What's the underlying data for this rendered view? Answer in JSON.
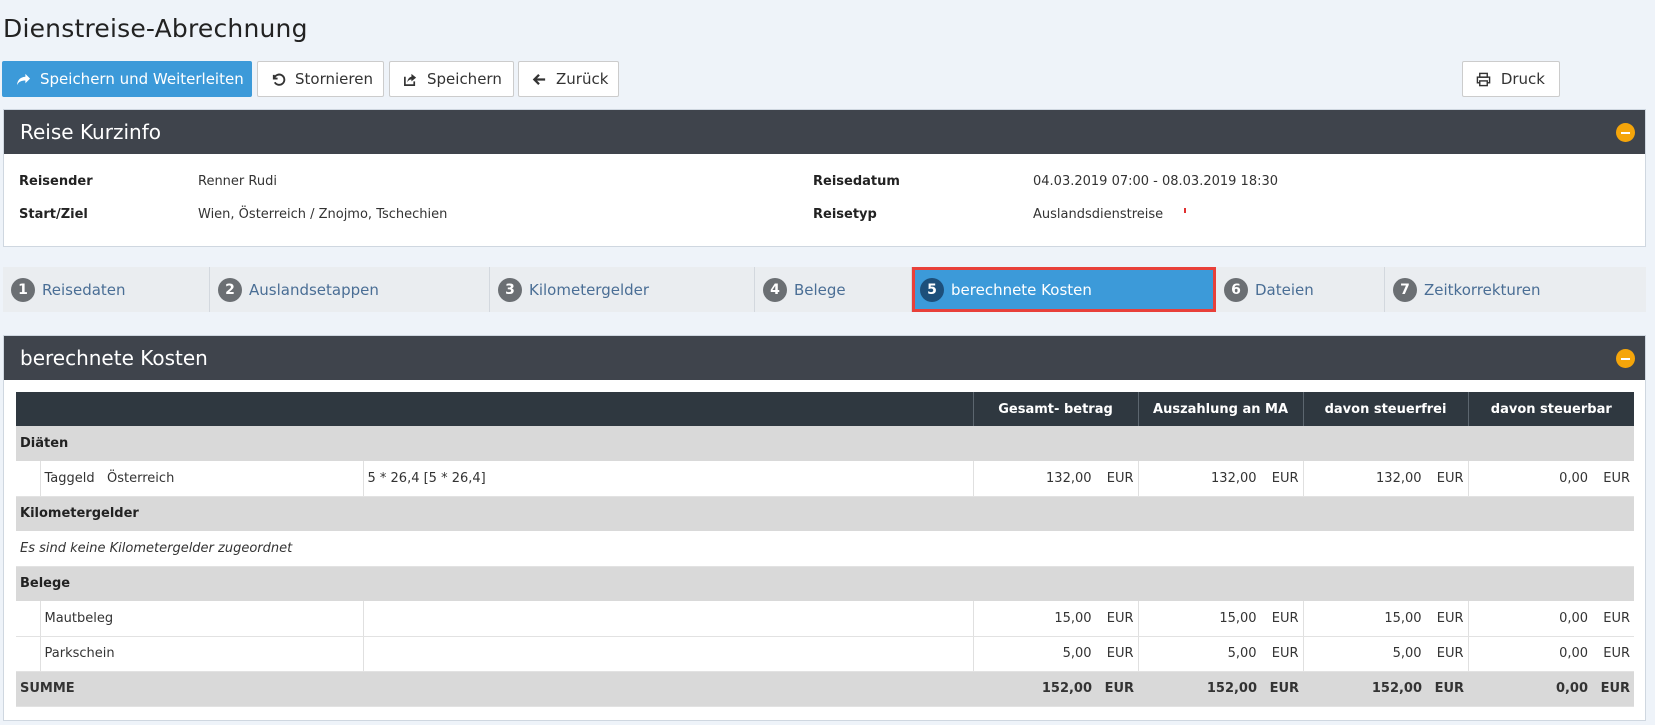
{
  "page": {
    "title": "Dienstreise-Abrechnung"
  },
  "toolbar": {
    "save_forward": "Speichern und Weiterleiten",
    "cancel": "Stornieren",
    "save": "Speichern",
    "back": "Zurück",
    "print": "Druck"
  },
  "info_panel": {
    "title": "Reise Kurzinfo",
    "traveler_label": "Reisender",
    "traveler_value": "Renner Rudi",
    "route_label": "Start/Ziel",
    "route_value": "Wien, Österreich / Znojmo, Tschechien",
    "date_label": "Reisedatum",
    "date_value": "04.03.2019 07:00 - 08.03.2019 18:30",
    "type_label": "Reisetyp",
    "type_value": "Auslandsdienstreise"
  },
  "tabs": [
    {
      "num": "1",
      "label": "Reisedaten"
    },
    {
      "num": "2",
      "label": "Auslandsetappen"
    },
    {
      "num": "3",
      "label": "Kilometergelder"
    },
    {
      "num": "4",
      "label": "Belege"
    },
    {
      "num": "5",
      "label": "berechnete Kosten",
      "active": true
    },
    {
      "num": "6",
      "label": "Dateien"
    },
    {
      "num": "7",
      "label": "Zeitkorrekturen"
    }
  ],
  "costs_panel": {
    "title": "berechnete Kosten",
    "columns": [
      "Gesamt- betrag",
      "Auszahlung an MA",
      "davon steuerfrei",
      "davon steuerbar"
    ],
    "currency": "EUR",
    "group_diaeten": "Diäten",
    "taggeld": {
      "label": "Taggeld",
      "country": "Österreich",
      "formula": "5 * 26,4 [5 * 26,4]",
      "values": [
        "132,00",
        "132,00",
        "132,00",
        "0,00"
      ]
    },
    "group_km": "Kilometergelder",
    "km_empty": "Es sind keine Kilometergelder zugeordnet",
    "group_belege": "Belege",
    "mautbeleg": {
      "label": "Mautbeleg",
      "values": [
        "15,00",
        "15,00",
        "15,00",
        "0,00"
      ]
    },
    "parkschein": {
      "label": "Parkschein",
      "values": [
        "5,00",
        "5,00",
        "5,00",
        "0,00"
      ]
    },
    "sum": {
      "label": "SUMME",
      "values": [
        "152,00",
        "152,00",
        "152,00",
        "0,00"
      ]
    }
  },
  "colors": {
    "primary": "#3c9ad9",
    "header_dark": "#3f444c",
    "accent_orange": "#f5a50a",
    "highlight_red": "#e8403a"
  }
}
